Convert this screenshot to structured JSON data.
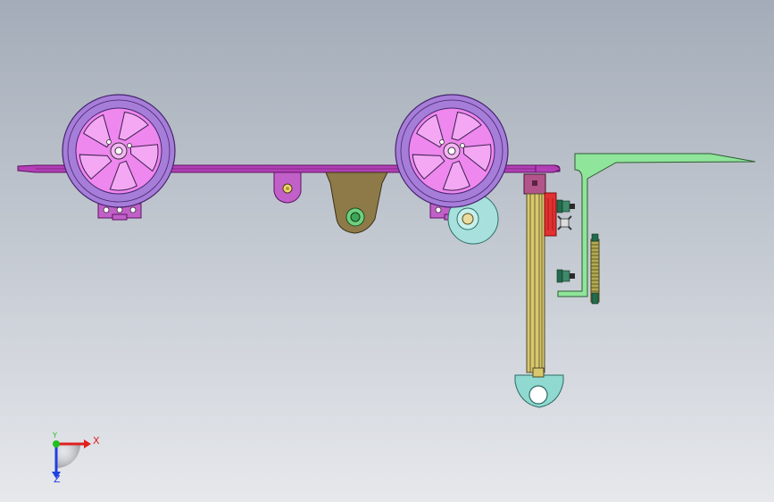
{
  "viewport": {
    "background_top": "#a3acb8",
    "background_bottom": "#e6e8ec"
  },
  "colors": {
    "plate": "#b23fb6",
    "plate_dark": "#5e1463",
    "tire": "#a67dd8",
    "tire_dark": "#44256d",
    "hub": "#ee87ee",
    "bracket": "#c160c8",
    "caster_housing": "#8d7a48",
    "caster_wheel": "#a7e0dc",
    "caster_hub": "#3da657",
    "rail": "#d8c76c",
    "rail_dark": "#4f4a2a",
    "rail_cap": "#b1558a",
    "foot": "#8fd9d0",
    "arm": "#8fe59a",
    "arm_dark": "#2e5b31",
    "red_block": "#e33030",
    "bolt": "#236b4e",
    "gear": "#b3aa55"
  },
  "triad": {
    "x_label": "X",
    "y_label": "Y",
    "z_label": "Z",
    "x_color": "#e02020",
    "y_color": "#20c020",
    "z_color": "#2040e0"
  }
}
